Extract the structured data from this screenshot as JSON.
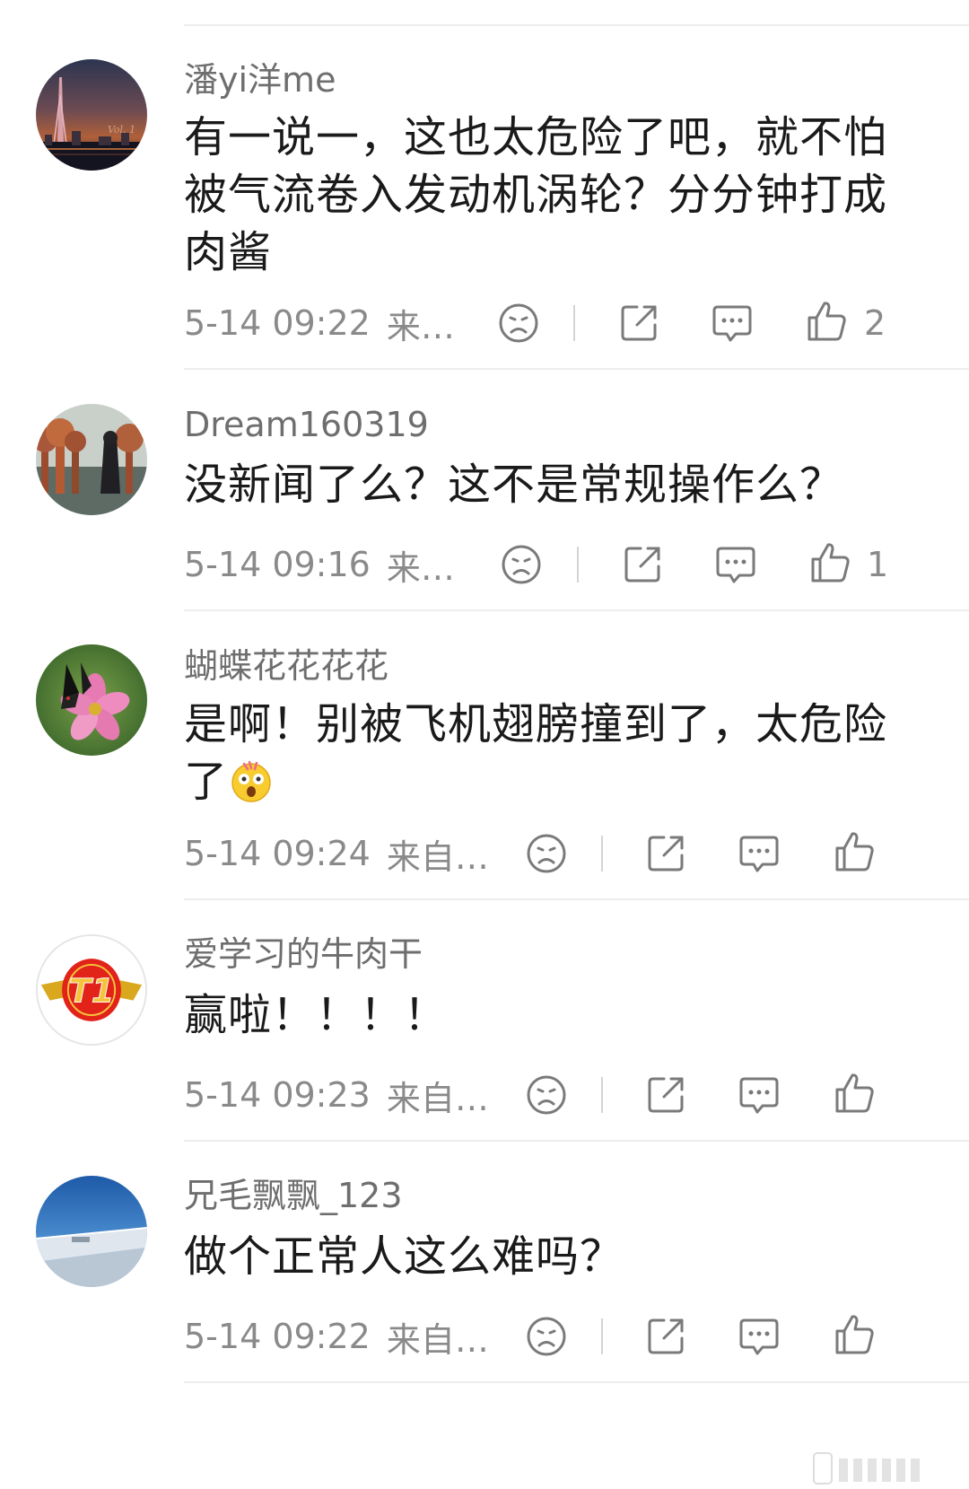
{
  "comments": [
    {
      "avatar": "city-night-avatar",
      "username": "潘yi洋me",
      "text_lines": [
        "有一说一，这也太危险了吧，就不怕",
        "被气流卷入发动机涡轮？分分钟打成",
        "肉酱"
      ],
      "time": "5-14 09:22",
      "source": "来…",
      "likes": "2"
    },
    {
      "avatar": "forest-woman-avatar",
      "username": "Dream160319",
      "text_lines": [
        "没新闻了么？这不是常规操作么？"
      ],
      "time": "5-14 09:16",
      "source": "来…",
      "likes": "1"
    },
    {
      "avatar": "butterfly-flower-avatar",
      "username": "蝴蝶花花花花",
      "text_lines": [
        "是啊！别被飞机翅膀撞到了，太危险",
        "了"
      ],
      "emoji": "shocked-face-emoji",
      "time": "5-14 09:24",
      "source": "来自…",
      "likes": ""
    },
    {
      "avatar": "t1-logo-avatar",
      "avatar_text": "T1",
      "username": "爱学习的牛肉干",
      "text_lines": [
        "赢啦！！！！"
      ],
      "time": "5-14 09:23",
      "source": "来自…",
      "likes": ""
    },
    {
      "avatar": "airplane-wing-avatar",
      "username": "兄毛飘飘_123",
      "text_lines": [
        "做个正常人这么难吗？"
      ],
      "time": "5-14 09:22",
      "source": "来自…",
      "likes": ""
    }
  ],
  "icons": {
    "dislike": "sad-face-icon",
    "share": "share-icon",
    "reply": "comment-bubble-icon",
    "like": "thumbs-up-icon"
  },
  "colors": {
    "text": "#1a1a1a",
    "username": "#6e6e6e",
    "meta": "#8a8a8a",
    "icon": "#7a7a7a",
    "divider": "#ededed"
  }
}
